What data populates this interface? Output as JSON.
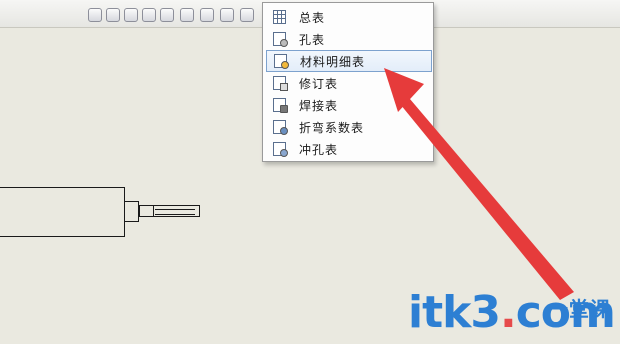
{
  "menu": {
    "items": [
      {
        "label": "总表",
        "icon": "general-table-icon"
      },
      {
        "label": "孔表",
        "icon": "hole-table-icon"
      },
      {
        "label": "材料明细表",
        "icon": "bill-of-materials-icon",
        "highlighted": true
      },
      {
        "label": "修订表",
        "icon": "revision-table-icon"
      },
      {
        "label": "焊接表",
        "icon": "weld-table-icon"
      },
      {
        "label": "折弯系数表",
        "icon": "bend-table-icon"
      },
      {
        "label": "冲孔表",
        "icon": "punch-table-icon"
      }
    ]
  },
  "watermark": {
    "brand_a": "itk3",
    "brand_dot": ".",
    "brand_b": "com",
    "tag": "一堂课"
  },
  "colors": {
    "arrow": "#e63b3b",
    "highlight_border": "#7da2ce",
    "canvas": "#eae9e0"
  }
}
